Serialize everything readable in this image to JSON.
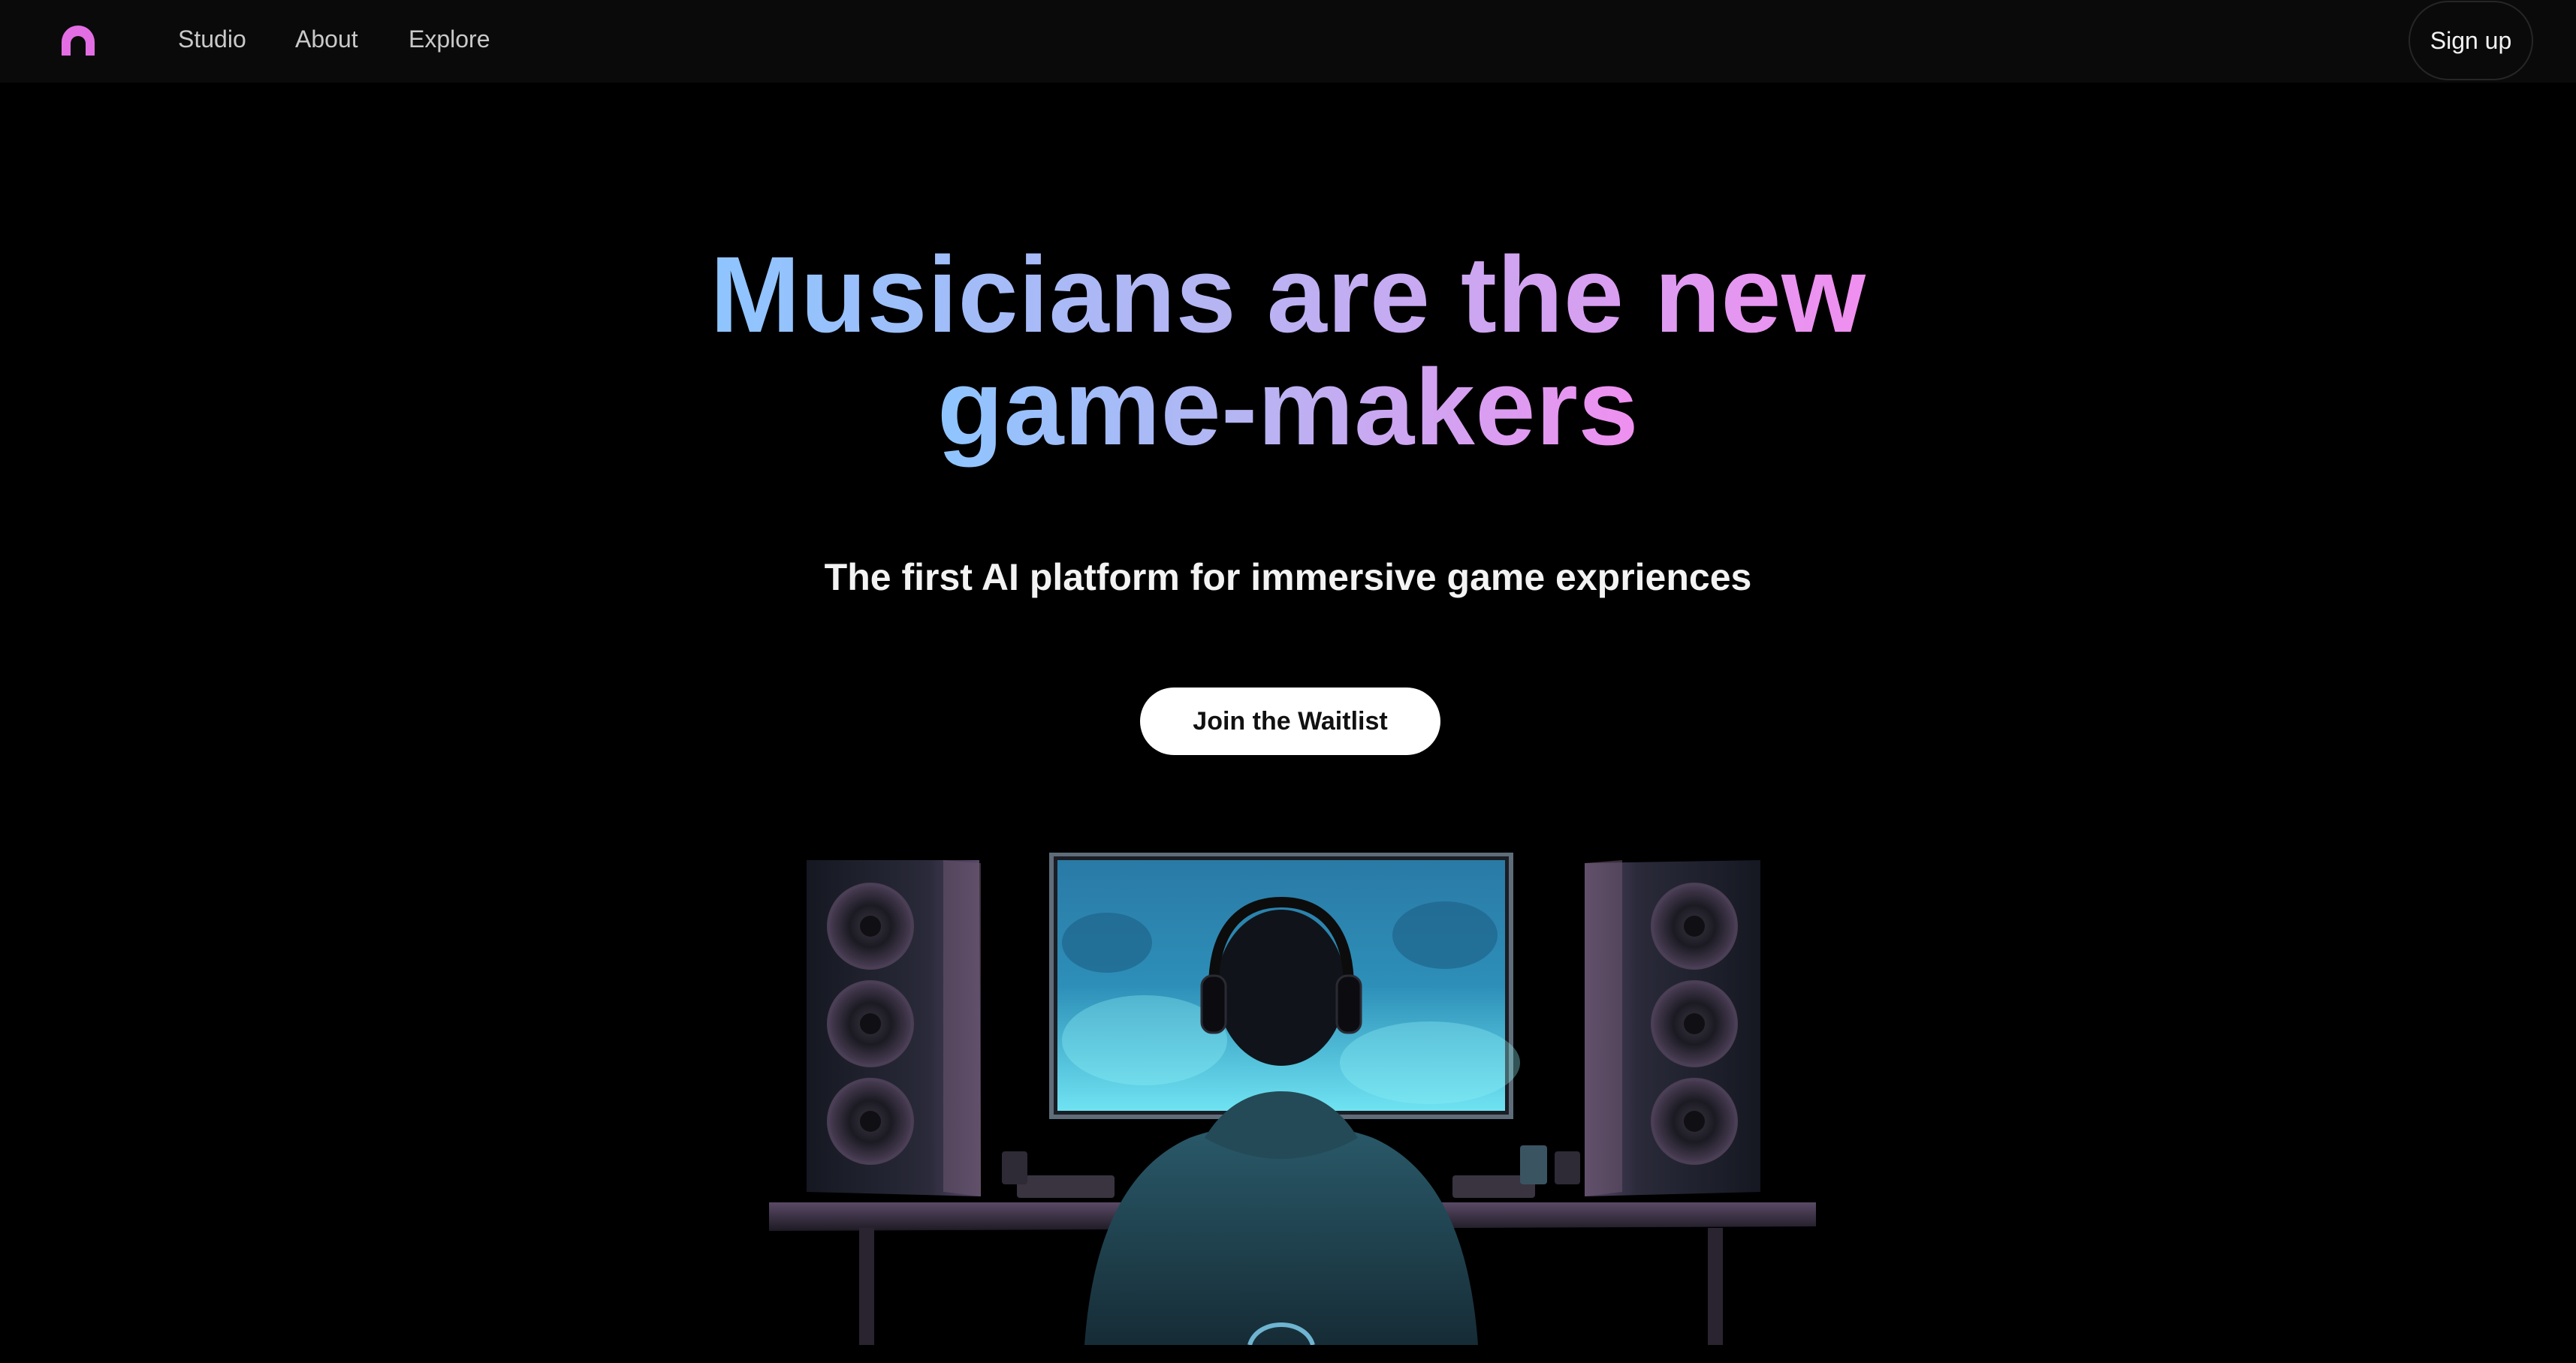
{
  "nav": {
    "links": [
      {
        "label": "Studio"
      },
      {
        "label": "About"
      },
      {
        "label": "Explore"
      }
    ],
    "signup_label": "Sign up"
  },
  "hero": {
    "headline_line1": "Musicians are the new",
    "headline_line2": "game-makers",
    "subtitle": "The first AI platform for immersive game expriences",
    "cta_label": "Join the Waitlist"
  },
  "colors": {
    "background": "#000000",
    "logo": "#e36ee4",
    "gradient_start": "#8ec5ff",
    "gradient_end": "#f08ff0",
    "cta_background": "#ffffff"
  },
  "image": {
    "subject": "musician-at-desk-with-speakers-and-monitor"
  }
}
